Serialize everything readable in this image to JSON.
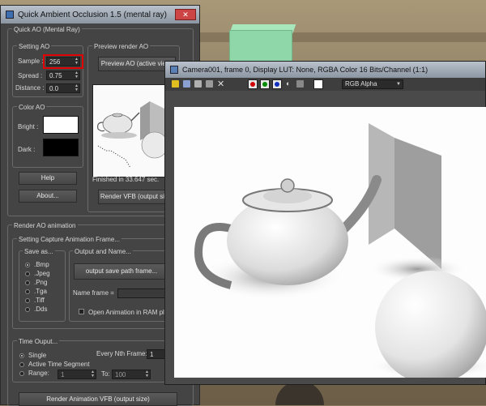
{
  "dialog": {
    "title": "Quick Ambient Occlusion 1.5  (mental ray)",
    "close": "✕",
    "group_main": "Quick AO (Mental Ray)",
    "setting_ao": "Setting AO",
    "sample_label": "Sample :",
    "sample_value": "256",
    "spread_label": "Spread :",
    "spread_value": "0.75",
    "distance_label": "Distance :",
    "distance_value": "0.0",
    "color_ao": "Color AO",
    "bright_label": "Bright :",
    "dark_label": "Dark :",
    "bright_color": "#ffffff",
    "dark_color": "#000000",
    "help": "Help",
    "about": "About...",
    "preview_group": "Preview render AO",
    "preview_button": "Preview AO (active view)",
    "finished": "Finished in 33.647 sec.",
    "render_vfb": "Render VFB (output size)",
    "render_anim_group": "Render AO animation",
    "capture_group": "Setting Capture Animation Frame...",
    "save_as": "Save as...",
    "formats": [
      ".Bmp",
      ".Jpeg",
      ".Png",
      ".Tga",
      ".Tiff",
      ".Dds"
    ],
    "output_group": "Output and Name...",
    "output_button": "output save path frame...",
    "name_frame": "Name frame =",
    "open_anim": "Open Animation in RAM player",
    "time_group": "Time Ouput...",
    "single": "Single",
    "active_time": "Active Time Segment",
    "range": "Range:",
    "range_from": "1",
    "range_to": "100",
    "to_label": "To:",
    "every_nth": "Every Nth Frame:",
    "every_nth_value": "1",
    "render_anim_button": "Render Animation VFB (output size)"
  },
  "framebuffer": {
    "title": "Camera001, frame 0, Display LUT: None, RGBA Color 16 Bits/Channel (1:1)",
    "channel": "RGB Alpha",
    "channel_colors": [
      "#d00000",
      "#008a00",
      "#1030c0"
    ]
  }
}
